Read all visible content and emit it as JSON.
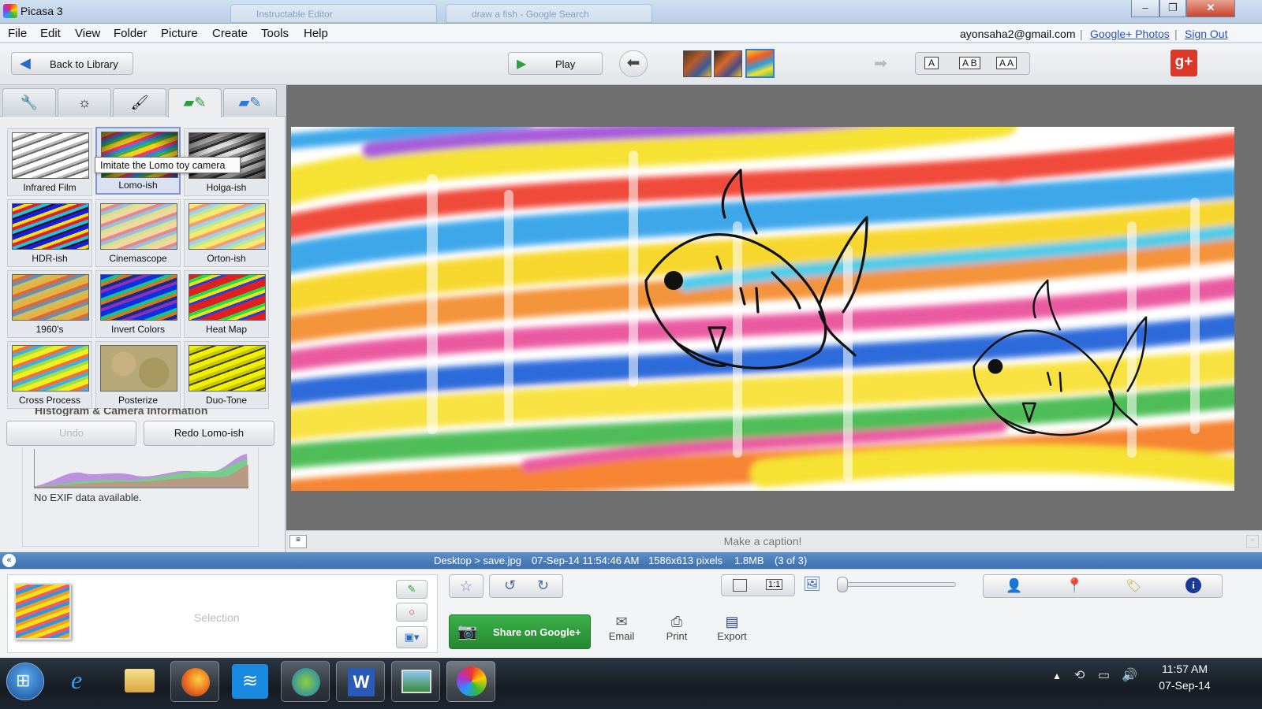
{
  "window": {
    "title": "Picasa 3",
    "ghost_tabs": [
      "Instructable Editor",
      "draw a fish - Google Search"
    ],
    "controls": [
      "–",
      "❐",
      "✕"
    ]
  },
  "menu": {
    "items": [
      "File",
      "Edit",
      "View",
      "Folder",
      "Picture",
      "Create",
      "Tools",
      "Help"
    ],
    "account_email": "ayonsaha2@gmail.com",
    "separator": "|",
    "google_photos_link": "Google+ Photos",
    "sign_out_link": "Sign Out"
  },
  "toolbar": {
    "back_label": "Back to Library",
    "play_label": "Play",
    "text_modes": [
      "A",
      "A B",
      "A A"
    ],
    "gplus": "g+"
  },
  "sidebar": {
    "tab_icons": [
      "wrench-icon",
      "sun-icon",
      "brush-icon",
      "effects-icon",
      "effects-2-icon"
    ],
    "effects": [
      {
        "label": "Infrared Film"
      },
      {
        "label": "Lomo-ish"
      },
      {
        "label": "Holga-ish"
      },
      {
        "label": "HDR-ish"
      },
      {
        "label": "Cinemascope"
      },
      {
        "label": "Orton-ish"
      },
      {
        "label": "1960's"
      },
      {
        "label": "Invert Colors"
      },
      {
        "label": "Heat Map"
      },
      {
        "label": "Cross Process"
      },
      {
        "label": "Posterize"
      },
      {
        "label": "Duo-Tone"
      }
    ],
    "selected_effect": "Lomo-ish",
    "tooltip": "Imitate the Lomo toy camera",
    "partial_heading": "Histogram & Camera Information",
    "undo_label": "Undo",
    "redo_label": "Redo Lomo-ish",
    "exif_text": "No EXIF data available."
  },
  "viewer": {
    "caption_placeholder": "Make a caption!"
  },
  "status": {
    "path": "Desktop > save.jpg",
    "datetime": "07-Sep-14 11:54:46 AM",
    "dimensions": "1586x613 pixels",
    "size": "1.8MB",
    "position": "(3 of 3)"
  },
  "tray": {
    "selection_label": "Selection",
    "share_label": "Share on Google+",
    "email_label": "Email",
    "print_label": "Print",
    "export_label": "Export",
    "zoom_1to1": "1:1"
  },
  "taskbar": {
    "time": "11:57 AM",
    "date": "07-Sep-14"
  },
  "colors": {
    "accent_blue": "#3e6fae",
    "share_green": "#2e9e3a",
    "link_blue": "#2a4fc8"
  }
}
